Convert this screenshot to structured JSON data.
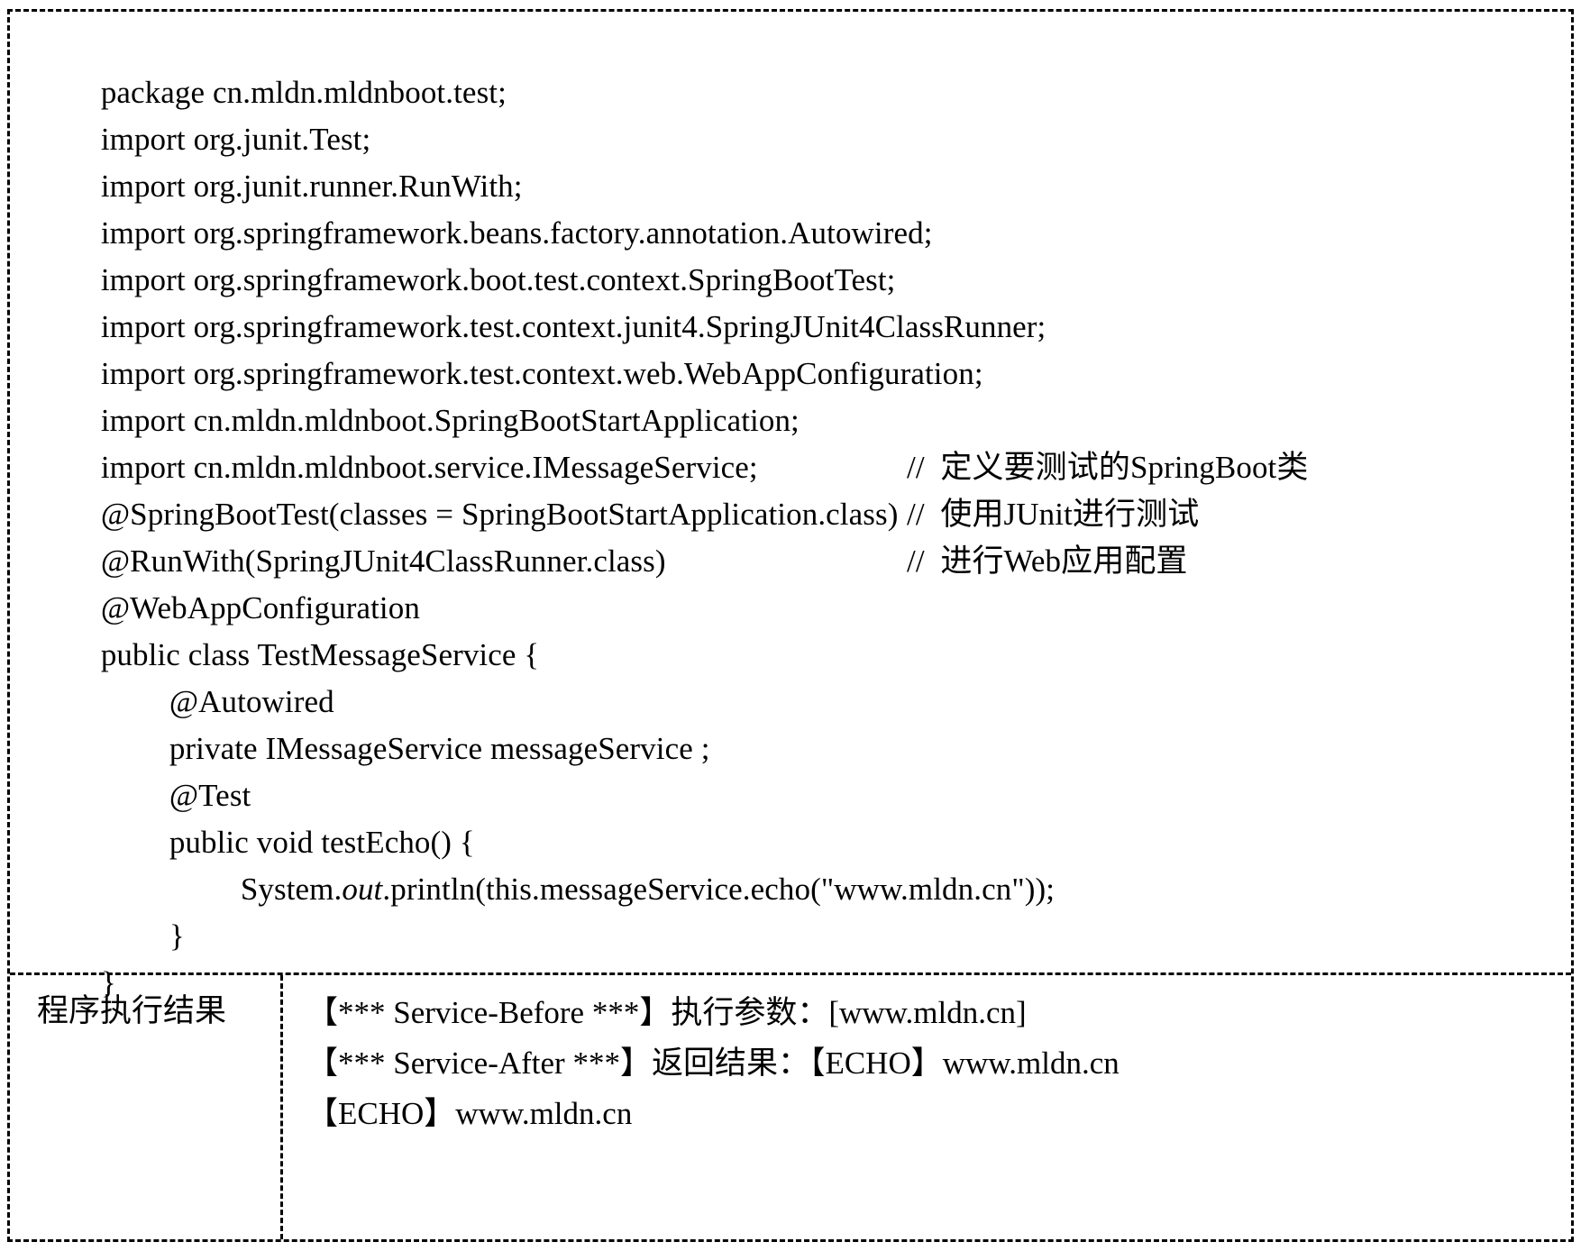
{
  "figure": {
    "kind": "code-listing-with-output",
    "border_style": "dashed",
    "text_color": "#000000",
    "background_color": "#ffffff"
  },
  "code": {
    "lines": [
      {
        "text": "package cn.mldn.mldnboot.test;",
        "indent": 0,
        "comment": ""
      },
      {
        "text": "import org.junit.Test;",
        "indent": 0,
        "comment": ""
      },
      {
        "text": "import org.junit.runner.RunWith;",
        "indent": 0,
        "comment": ""
      },
      {
        "text": "import org.springframework.beans.factory.annotation.Autowired;",
        "indent": 0,
        "comment": ""
      },
      {
        "text": "import org.springframework.boot.test.context.SpringBootTest;",
        "indent": 0,
        "comment": ""
      },
      {
        "text": "import org.springframework.test.context.junit4.SpringJUnit4ClassRunner;",
        "indent": 0,
        "comment": ""
      },
      {
        "text": "import org.springframework.test.context.web.WebAppConfiguration;",
        "indent": 0,
        "comment": ""
      },
      {
        "text": "import cn.mldn.mldnboot.SpringBootStartApplication;",
        "indent": 0,
        "comment": ""
      },
      {
        "text": "import cn.mldn.mldnboot.service.IMessageService;",
        "indent": 0,
        "comment": ""
      },
      {
        "text": "@SpringBootTest(classes = SpringBootStartApplication.class)",
        "indent": 0,
        "comment": "//  定义要测试的SpringBoot类"
      },
      {
        "text": "@RunWith(SpringJUnit4ClassRunner.class)",
        "indent": 0,
        "comment": "//  使用JUnit进行测试"
      },
      {
        "text": "@WebAppConfiguration",
        "indent": 0,
        "comment": "//  进行Web应用配置"
      },
      {
        "text": "public class TestMessageService {",
        "indent": 0,
        "comment": ""
      },
      {
        "text": "@Autowired",
        "indent": 1,
        "comment": ""
      },
      {
        "text": "private IMessageService messageService ;",
        "indent": 1,
        "comment": ""
      },
      {
        "text": "@Test",
        "indent": 1,
        "comment": ""
      },
      {
        "text": "public void testEcho() {",
        "indent": 1,
        "comment": ""
      },
      {
        "text": "System.out.println(this.messageService.echo(\"www.mldn.cn\"));",
        "indent": 2,
        "comment": "",
        "italic_token": "out"
      },
      {
        "text": "}",
        "indent": 1,
        "comment": ""
      },
      {
        "text": "}",
        "indent": 0,
        "comment": ""
      }
    ]
  },
  "result": {
    "label": "程序执行结果",
    "lines": [
      "【*** Service-Before ***】执行参数：[www.mldn.cn]",
      "【*** Service-After ***】返回结果：【ECHO】www.mldn.cn",
      "【ECHO】www.mldn.cn"
    ]
  }
}
